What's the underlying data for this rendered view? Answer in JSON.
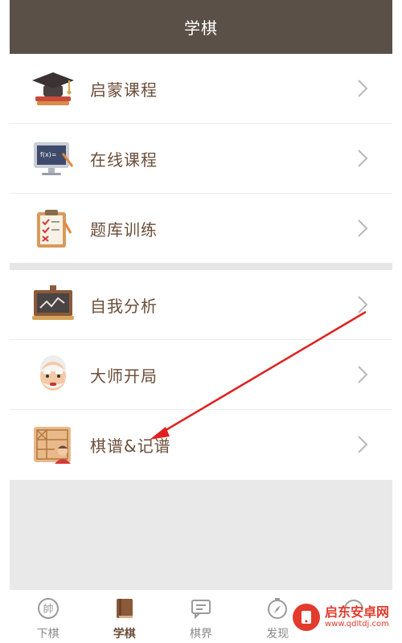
{
  "header": {
    "title": "学棋"
  },
  "group1": [
    {
      "label": "启蒙课程",
      "icon": "graduation-cap-icon"
    },
    {
      "label": "在线课程",
      "icon": "monitor-icon"
    },
    {
      "label": "题库训练",
      "icon": "clipboard-icon"
    }
  ],
  "group2": [
    {
      "label": "自我分析",
      "icon": "chart-board-icon"
    },
    {
      "label": "大师开局",
      "icon": "master-avatar-icon"
    },
    {
      "label": "棋谱&记谱",
      "icon": "chess-record-icon"
    }
  ],
  "tabs": [
    {
      "label": "下棋",
      "icon": "shuai-piece-icon",
      "active": false
    },
    {
      "label": "学棋",
      "icon": "book-icon",
      "active": true
    },
    {
      "label": "棋界",
      "icon": "chat-icon",
      "active": false
    },
    {
      "label": "发现",
      "icon": "compass-icon",
      "active": false
    },
    {
      "label": "",
      "icon": "more-icon",
      "active": false
    }
  ],
  "watermark": {
    "title": "启东安卓网",
    "url": "www.qdltdj.com"
  },
  "colors": {
    "header_bg": "#5a5048",
    "label": "#6b4e3a",
    "arrow": "#e02020"
  }
}
